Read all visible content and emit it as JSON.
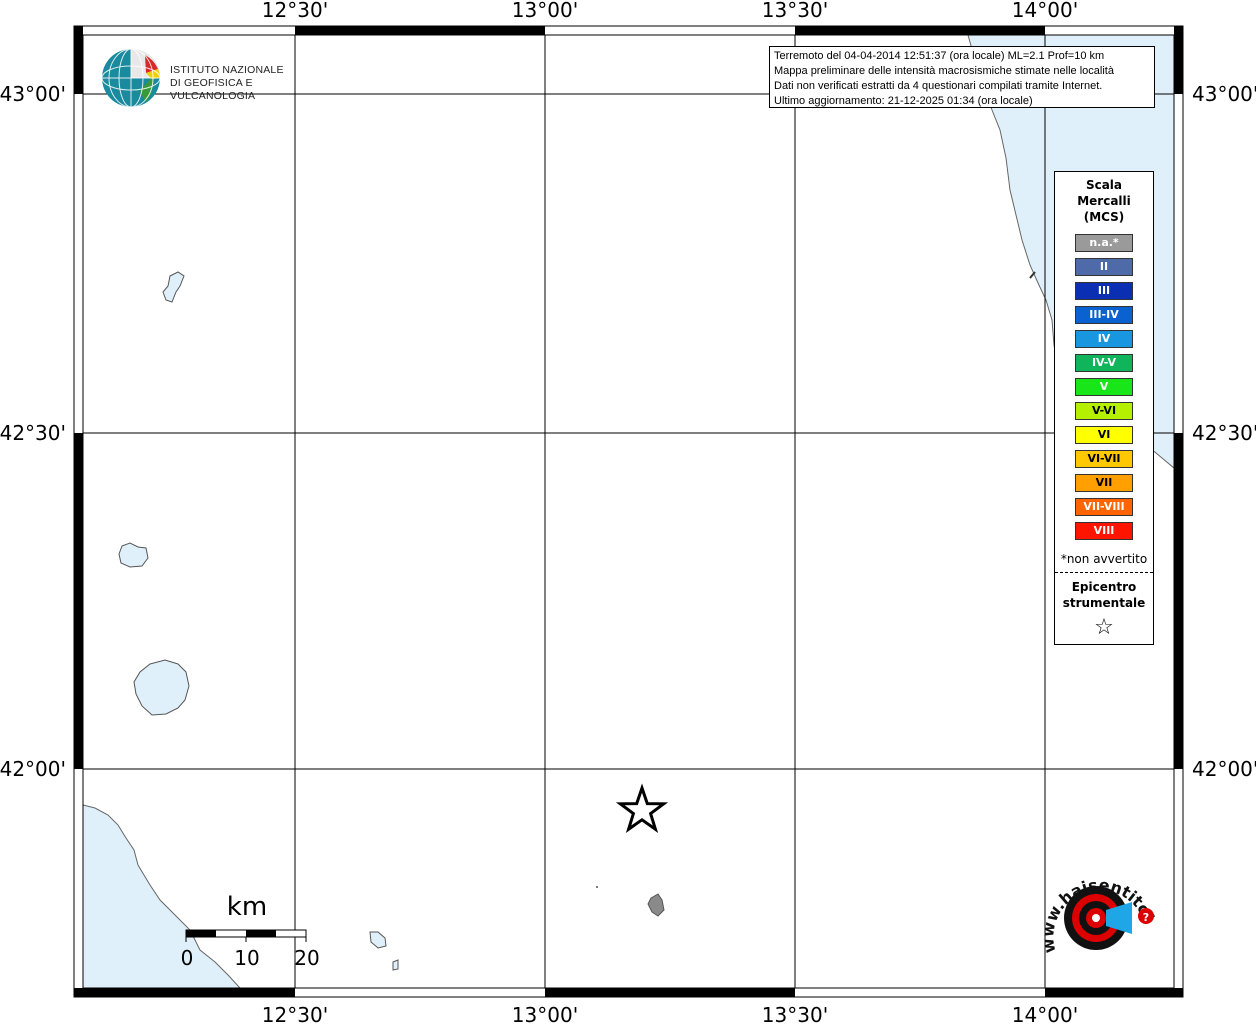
{
  "map": {
    "top_ticks": [
      "12°30'",
      "13°00'",
      "13°30'",
      "14°00'"
    ],
    "bottom_ticks": [
      "12°30'",
      "13°00'",
      "13°30'",
      "14°00'"
    ],
    "left_ticks": [
      "43°00'",
      "42°30'",
      "42°00'"
    ],
    "right_ticks": [
      "43°00'",
      "42°30'",
      "42°00'"
    ],
    "colors": {
      "sea": "#e0f0fa",
      "land": "#ffffff",
      "grid": "#000000",
      "coast": "#666666"
    }
  },
  "logo": {
    "ingv_line1": "ISTITUTO NAZIONALE",
    "ingv_line2": "DI GEOFISICA E VULCANOLOGIA"
  },
  "info": {
    "line1": "Terremoto del 04-04-2014 12:51:37 (ora locale) ML=2.1 Prof=10 km",
    "line2": "Mappa preliminare delle intensità macrosismiche stimate nelle località",
    "line3": "Dati non verificati estratti da 4 questionari compilati tramite Internet.",
    "line4": "Ultimo aggiornamento: 21-12-2025 01:34 (ora locale)"
  },
  "legend": {
    "title1": "Scala",
    "title2": "Mercalli",
    "title3": "(MCS)",
    "items": [
      {
        "label": "n.a.*",
        "color": "#9a9a9a"
      },
      {
        "label": "II",
        "color": "#4f6aa8"
      },
      {
        "label": "III",
        "color": "#0b2fb3"
      },
      {
        "label": "III-IV",
        "color": "#0a62d0"
      },
      {
        "label": "IV",
        "color": "#1896e0"
      },
      {
        "label": "IV-V",
        "color": "#10b45a"
      },
      {
        "label": "V",
        "color": "#19e619"
      },
      {
        "label": "V-VI",
        "color": "#b4f000"
      },
      {
        "label": "VI",
        "color": "#ffff00"
      },
      {
        "label": "VI-VII",
        "color": "#ffc800"
      },
      {
        "label": "VII",
        "color": "#ffa000"
      },
      {
        "label": "VII-VIII",
        "color": "#ff6400"
      },
      {
        "label": "VIII",
        "color": "#ff1400"
      }
    ],
    "note": "*non avvertito",
    "epi1": "Epicentro",
    "epi2": "strumentale"
  },
  "scale_bar": {
    "unit": "km",
    "labels": [
      "0",
      "10",
      "20"
    ]
  },
  "haisentito": {
    "text": "www.haisentitoilterremoto.it"
  }
}
